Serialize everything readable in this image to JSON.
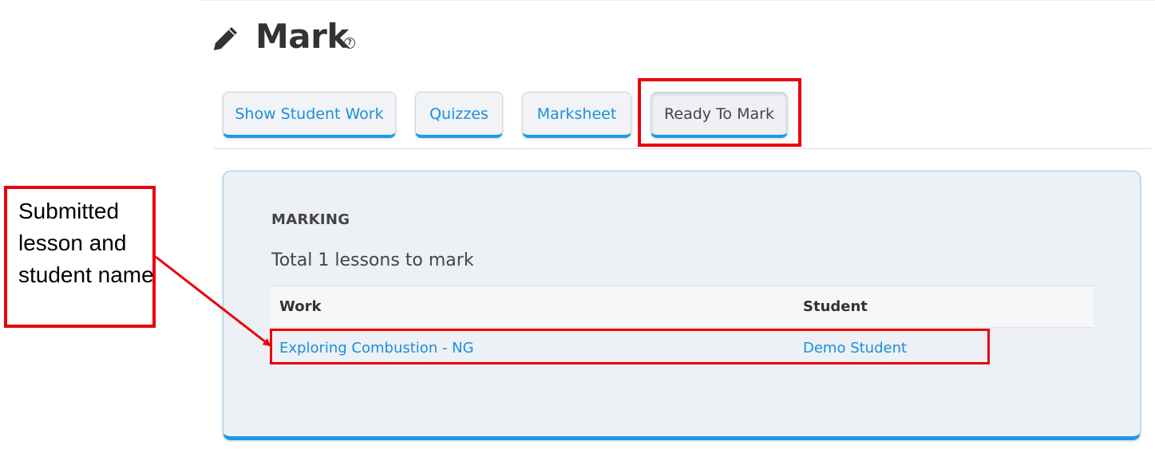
{
  "header": {
    "title": "Mark",
    "title_icon": "pencil-icon",
    "help_glyph": "?"
  },
  "tabs": [
    {
      "label": "Show Student Work",
      "active": false
    },
    {
      "label": "Quizzes",
      "active": false
    },
    {
      "label": "Marksheet",
      "active": false
    },
    {
      "label": "Ready To Mark",
      "active": true
    }
  ],
  "panel": {
    "heading": "MARKING",
    "total_text": "Total 1 lessons to mark",
    "table": {
      "columns": [
        "Work",
        "Student"
      ],
      "rows": [
        {
          "work": "Exploring Combustion - NG",
          "student": "Demo Student"
        }
      ]
    }
  },
  "annotation": {
    "callout_text": "Submitted lesson and student name",
    "color": "#e8000b"
  },
  "colors": {
    "accent": "#1c9be6",
    "link": "#1a8fdc",
    "panel_bg": "#edf0f4"
  }
}
